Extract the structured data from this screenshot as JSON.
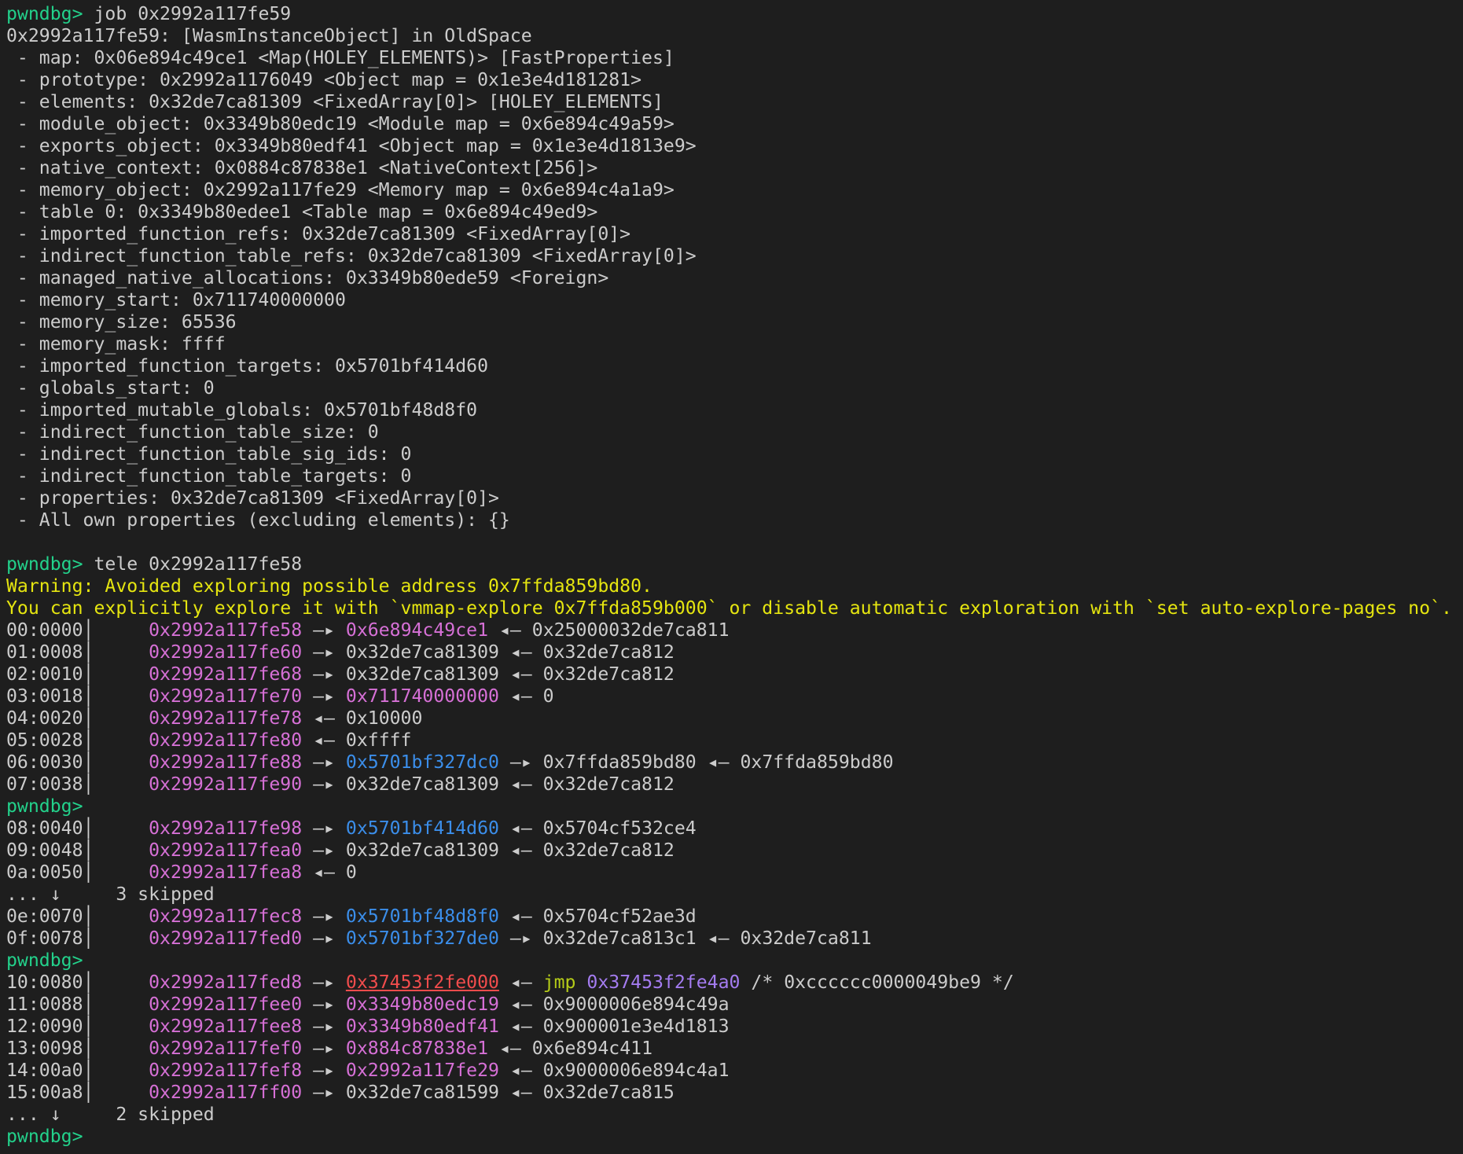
{
  "colors": {
    "background": "#1e1e1e",
    "foreground": "#cccccc",
    "prompt": "#23d18b",
    "warning": "#e5e510",
    "stack_address": "#d670d6",
    "code_pointer": "#3b8eea",
    "rwx_pointer": "#f14c4c",
    "instruction": "#b5cc18",
    "jump_target": "#a47cf0"
  },
  "terminal": {
    "lines": [
      [
        {
          "t": "pwndbg> ",
          "c": "prompt"
        },
        {
          "t": "job 0x2992a117fe59",
          "c": "text"
        }
      ],
      [
        {
          "t": "0x2992a117fe59: [WasmInstanceObject] in OldSpace",
          "c": "text"
        }
      ],
      [
        {
          "t": " - map: 0x06e894c49ce1 <Map(HOLEY_ELEMENTS)> [FastProperties]",
          "c": "text"
        }
      ],
      [
        {
          "t": " - prototype: 0x2992a1176049 <Object map = 0x1e3e4d181281>",
          "c": "text"
        }
      ],
      [
        {
          "t": " - elements: 0x32de7ca81309 <FixedArray[0]> [HOLEY_ELEMENTS]",
          "c": "text"
        }
      ],
      [
        {
          "t": " - module_object: 0x3349b80edc19 <Module map = 0x6e894c49a59>",
          "c": "text"
        }
      ],
      [
        {
          "t": " - exports_object: 0x3349b80edf41 <Object map = 0x1e3e4d1813e9>",
          "c": "text"
        }
      ],
      [
        {
          "t": " - native_context: 0x0884c87838e1 <NativeContext[256]>",
          "c": "text"
        }
      ],
      [
        {
          "t": " - memory_object: 0x2992a117fe29 <Memory map = 0x6e894c4a1a9>",
          "c": "text"
        }
      ],
      [
        {
          "t": " - table 0: 0x3349b80edee1 <Table map = 0x6e894c49ed9>",
          "c": "text"
        }
      ],
      [
        {
          "t": " - imported_function_refs: 0x32de7ca81309 <FixedArray[0]>",
          "c": "text"
        }
      ],
      [
        {
          "t": " - indirect_function_table_refs: 0x32de7ca81309 <FixedArray[0]>",
          "c": "text"
        }
      ],
      [
        {
          "t": " - managed_native_allocations: 0x3349b80ede59 <Foreign>",
          "c": "text"
        }
      ],
      [
        {
          "t": " - memory_start: 0x711740000000",
          "c": "text"
        }
      ],
      [
        {
          "t": " - memory_size: 65536",
          "c": "text"
        }
      ],
      [
        {
          "t": " - memory_mask: ffff",
          "c": "text"
        }
      ],
      [
        {
          "t": " - imported_function_targets: 0x5701bf414d60",
          "c": "text"
        }
      ],
      [
        {
          "t": " - globals_start: 0",
          "c": "text"
        }
      ],
      [
        {
          "t": " - imported_mutable_globals: 0x5701bf48d8f0",
          "c": "text"
        }
      ],
      [
        {
          "t": " - indirect_function_table_size: 0",
          "c": "text"
        }
      ],
      [
        {
          "t": " - indirect_function_table_sig_ids: 0",
          "c": "text"
        }
      ],
      [
        {
          "t": " - indirect_function_table_targets: 0",
          "c": "text"
        }
      ],
      [
        {
          "t": " - properties: 0x32de7ca81309 <FixedArray[0]>",
          "c": "text"
        }
      ],
      [
        {
          "t": " - All own properties (excluding elements): {}",
          "c": "text"
        }
      ],
      [],
      [
        {
          "t": "pwndbg> ",
          "c": "prompt"
        },
        {
          "t": "tele 0x2992a117fe58",
          "c": "text"
        }
      ],
      [
        {
          "t": "Warning: Avoided exploring possible address 0x7ffda859bd80.",
          "c": "warn"
        }
      ],
      [
        {
          "t": "You can explicitly explore it with `vmmap-explore 0x7ffda859b000` or disable automatic exploration with `set auto-explore-pages no`.",
          "c": "warn"
        }
      ],
      [
        {
          "t": "00:0000│     ",
          "c": "text"
        },
        {
          "t": "0x2992a117fe58",
          "c": "addr"
        },
        {
          "t": " —▸ ",
          "c": "text"
        },
        {
          "t": "0x6e894c49ce1",
          "c": "heap"
        },
        {
          "t": " ◂— 0x25000032de7ca811",
          "c": "text"
        }
      ],
      [
        {
          "t": "01:0008│     ",
          "c": "text"
        },
        {
          "t": "0x2992a117fe60",
          "c": "addr"
        },
        {
          "t": " —▸ 0x32de7ca81309 ◂— 0x32de7ca812",
          "c": "text"
        }
      ],
      [
        {
          "t": "02:0010│     ",
          "c": "text"
        },
        {
          "t": "0x2992a117fe68",
          "c": "addr"
        },
        {
          "t": " —▸ 0x32de7ca81309 ◂— 0x32de7ca812",
          "c": "text"
        }
      ],
      [
        {
          "t": "03:0018│     ",
          "c": "text"
        },
        {
          "t": "0x2992a117fe70",
          "c": "addr"
        },
        {
          "t": " —▸ ",
          "c": "text"
        },
        {
          "t": "0x711740000000",
          "c": "heap"
        },
        {
          "t": " ◂— 0",
          "c": "text"
        }
      ],
      [
        {
          "t": "04:0020│     ",
          "c": "text"
        },
        {
          "t": "0x2992a117fe78",
          "c": "addr"
        },
        {
          "t": " ◂— 0x10000",
          "c": "text"
        }
      ],
      [
        {
          "t": "05:0028│     ",
          "c": "text"
        },
        {
          "t": "0x2992a117fe80",
          "c": "addr"
        },
        {
          "t": " ◂— 0xffff",
          "c": "text"
        }
      ],
      [
        {
          "t": "06:0030│     ",
          "c": "text"
        },
        {
          "t": "0x2992a117fe88",
          "c": "addr"
        },
        {
          "t": " —▸ ",
          "c": "text"
        },
        {
          "t": "0x5701bf327dc0",
          "c": "code"
        },
        {
          "t": " —▸ 0x7ffda859bd80 ◂— 0x7ffda859bd80",
          "c": "text"
        }
      ],
      [
        {
          "t": "07:0038│     ",
          "c": "text"
        },
        {
          "t": "0x2992a117fe90",
          "c": "addr"
        },
        {
          "t": " —▸ 0x32de7ca81309 ◂— 0x32de7ca812",
          "c": "text"
        }
      ],
      [
        {
          "t": "pwndbg>",
          "c": "prompt"
        }
      ],
      [
        {
          "t": "08:0040│     ",
          "c": "text"
        },
        {
          "t": "0x2992a117fe98",
          "c": "addr"
        },
        {
          "t": " —▸ ",
          "c": "text"
        },
        {
          "t": "0x5701bf414d60",
          "c": "code"
        },
        {
          "t": " ◂— 0x5704cf532ce4",
          "c": "text"
        }
      ],
      [
        {
          "t": "09:0048│     ",
          "c": "text"
        },
        {
          "t": "0x2992a117fea0",
          "c": "addr"
        },
        {
          "t": " —▸ 0x32de7ca81309 ◂— 0x32de7ca812",
          "c": "text"
        }
      ],
      [
        {
          "t": "0a:0050│     ",
          "c": "text"
        },
        {
          "t": "0x2992a117fea8",
          "c": "addr"
        },
        {
          "t": " ◂— 0",
          "c": "text"
        }
      ],
      [
        {
          "t": "... ↓     3 skipped",
          "c": "text"
        }
      ],
      [
        {
          "t": "0e:0070│     ",
          "c": "text"
        },
        {
          "t": "0x2992a117fec8",
          "c": "addr"
        },
        {
          "t": " —▸ ",
          "c": "text"
        },
        {
          "t": "0x5701bf48d8f0",
          "c": "code"
        },
        {
          "t": " ◂— 0x5704cf52ae3d",
          "c": "text"
        }
      ],
      [
        {
          "t": "0f:0078│     ",
          "c": "text"
        },
        {
          "t": "0x2992a117fed0",
          "c": "addr"
        },
        {
          "t": " —▸ ",
          "c": "text"
        },
        {
          "t": "0x5701bf327de0",
          "c": "code"
        },
        {
          "t": " —▸ 0x32de7ca813c1 ◂— 0x32de7ca811",
          "c": "text"
        }
      ],
      [
        {
          "t": "pwndbg>",
          "c": "prompt"
        }
      ],
      [
        {
          "t": "10:0080│     ",
          "c": "text"
        },
        {
          "t": "0x2992a117fed8",
          "c": "addr"
        },
        {
          "t": " —▸ ",
          "c": "text"
        },
        {
          "t": "0x37453f2fe000",
          "c": "rwx"
        },
        {
          "t": " ◂— ",
          "c": "text"
        },
        {
          "t": "jmp ",
          "c": "jmp"
        },
        {
          "t": "0x37453f2fe4a0",
          "c": "target"
        },
        {
          "t": " /* 0xcccccc0000049be9 */",
          "c": "text"
        }
      ],
      [
        {
          "t": "11:0088│     ",
          "c": "text"
        },
        {
          "t": "0x2992a117fee0",
          "c": "addr"
        },
        {
          "t": " —▸ ",
          "c": "text"
        },
        {
          "t": "0x3349b80edc19",
          "c": "heap"
        },
        {
          "t": " ◂— 0x9000006e894c49a",
          "c": "text"
        }
      ],
      [
        {
          "t": "12:0090│     ",
          "c": "text"
        },
        {
          "t": "0x2992a117fee8",
          "c": "addr"
        },
        {
          "t": " —▸ ",
          "c": "text"
        },
        {
          "t": "0x3349b80edf41",
          "c": "heap"
        },
        {
          "t": " ◂— 0x900001e3e4d1813",
          "c": "text"
        }
      ],
      [
        {
          "t": "13:0098│     ",
          "c": "text"
        },
        {
          "t": "0x2992a117fef0",
          "c": "addr"
        },
        {
          "t": " —▸ ",
          "c": "text"
        },
        {
          "t": "0x884c87838e1",
          "c": "heap"
        },
        {
          "t": " ◂— 0x6e894c411",
          "c": "text"
        }
      ],
      [
        {
          "t": "14:00a0│     ",
          "c": "text"
        },
        {
          "t": "0x2992a117fef8",
          "c": "addr"
        },
        {
          "t": " —▸ ",
          "c": "text"
        },
        {
          "t": "0x2992a117fe29",
          "c": "heap"
        },
        {
          "t": " ◂— 0x9000006e894c4a1",
          "c": "text"
        }
      ],
      [
        {
          "t": "15:00a8│     ",
          "c": "text"
        },
        {
          "t": "0x2992a117ff00",
          "c": "addr"
        },
        {
          "t": " —▸ 0x32de7ca81599 ◂— 0x32de7ca815",
          "c": "text"
        }
      ],
      [
        {
          "t": "... ↓     2 skipped",
          "c": "text"
        }
      ],
      [
        {
          "t": "pwndbg>",
          "c": "prompt"
        }
      ]
    ]
  }
}
